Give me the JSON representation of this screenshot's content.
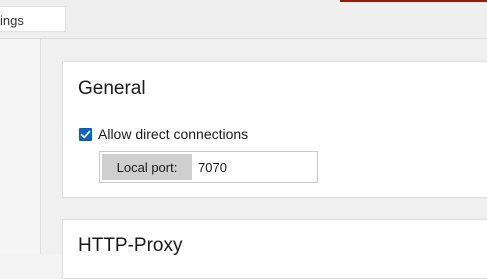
{
  "tab": {
    "label": "ings"
  },
  "general": {
    "title": "General",
    "allow_direct": {
      "label": "Allow direct connections",
      "checked": true
    },
    "local_port": {
      "label": "Local port:",
      "value": "7070"
    }
  },
  "http_proxy": {
    "title": "HTTP-Proxy"
  },
  "colors": {
    "accent": "#0a64c8",
    "card_background": "#ffffff",
    "page_background": "#f0f0f0",
    "label_chip": "#cfcfcf",
    "top_strip": "#8a2214"
  }
}
